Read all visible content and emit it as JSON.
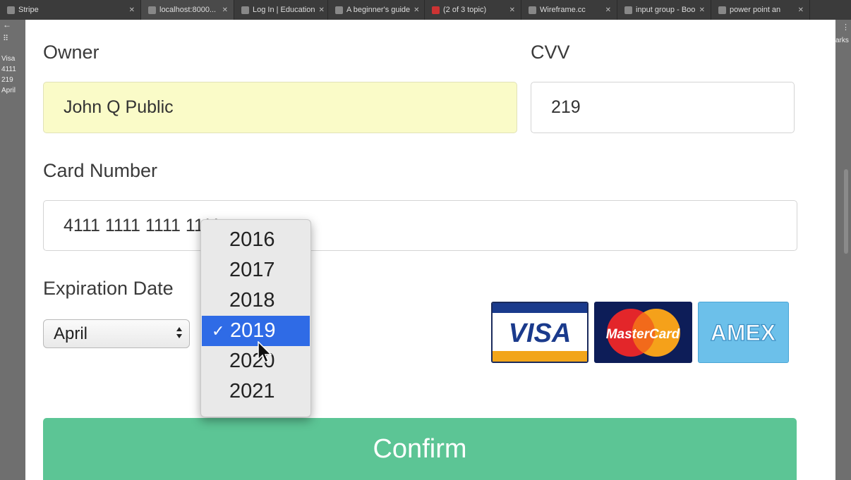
{
  "browser": {
    "tabs": [
      {
        "label": "Stripe"
      },
      {
        "label": "localhost:8000..."
      },
      {
        "label": "Log In | Education"
      },
      {
        "label": "A beginner's guide"
      },
      {
        "label": "(2 of 3 topic)"
      },
      {
        "label": "Wireframe.cc"
      },
      {
        "label": "input group - Boo"
      },
      {
        "label": "power point an"
      }
    ],
    "bookmarks_label": "arks"
  },
  "background_page": {
    "lines": [
      "Visa",
      "4111",
      "219",
      "April"
    ]
  },
  "form": {
    "owner_label": "Owner",
    "owner_value": "John Q Public",
    "cvv_label": "CVV",
    "cvv_value": "219",
    "card_number_label": "Card Number",
    "card_number_value": "4111 1111 1111 1111",
    "expiration_label": "Expiration Date",
    "month_selected": "April",
    "year_options": [
      "2016",
      "2017",
      "2018",
      "2019",
      "2020",
      "2021"
    ],
    "year_selected": "2019",
    "confirm_label": "Confirm"
  },
  "card_logos": {
    "visa": "VISA",
    "mastercard": "MasterCard",
    "amex": "AMEX"
  },
  "colors": {
    "confirm_green": "#5cc595",
    "autofill_yellow": "#fafbc8",
    "selected_option_blue": "#2f6be6"
  }
}
